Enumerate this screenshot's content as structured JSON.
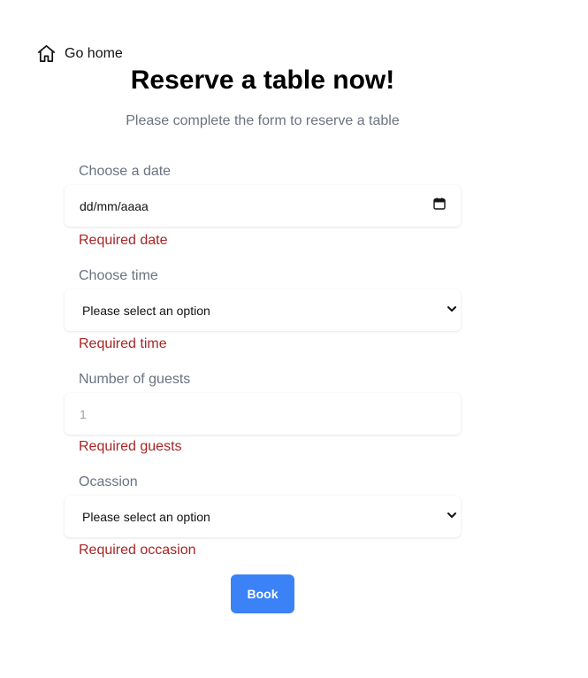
{
  "nav": {
    "go_home_label": "Go home",
    "home_icon": "home-icon"
  },
  "header": {
    "title": "Reserve a table now!",
    "subtitle": "Please complete the form to reserve a table"
  },
  "form": {
    "date": {
      "label": "Choose a date",
      "value": "dd/mm/aaaa",
      "error": "Required date",
      "icon": "calendar-icon"
    },
    "time": {
      "label": "Choose time",
      "value": "Please select an option",
      "error": "Required time",
      "icon": "chevron-down-icon"
    },
    "guests": {
      "label": "Number of guests",
      "placeholder": "1",
      "error": "Required guests"
    },
    "occasion": {
      "label": "Ocassion",
      "value": "Please select an option",
      "error": "Required occasion",
      "icon": "chevron-down-icon"
    },
    "submit_label": "Book"
  },
  "colors": {
    "primary": "#3b82f6",
    "error": "#a72525",
    "muted": "#6b7280"
  }
}
